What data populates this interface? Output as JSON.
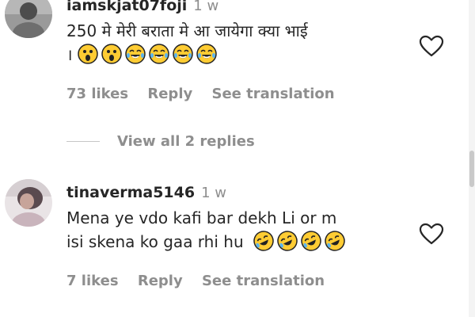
{
  "comments": [
    {
      "username": "iamskjat07foji",
      "time": "1 w",
      "lines": [
        "250 मे मेरी बराता मे आ जायेगा क्या भाई"
      ],
      "line2_prefix": "।",
      "emojis": [
        "astonished-face",
        "astonished-face",
        "joy-face",
        "joy-face",
        "joy-face",
        "joy-face"
      ],
      "likes": "73 likes",
      "reply": "Reply",
      "translate": "See translation"
    },
    {
      "username": "tinaverma5146",
      "time": "1 w",
      "lines": [
        "Mena ye vdo kafi bar dekh Li or m",
        "isi skena ko gaa rhi hu"
      ],
      "emojis": [
        "rofl-face",
        "rofl-face",
        "rofl-face",
        "rofl-face"
      ],
      "likes": "7 likes",
      "reply": "Reply",
      "translate": "See translation"
    }
  ],
  "view_replies": "View all 2 replies",
  "icons": {
    "like": "heart-outline-icon"
  },
  "colors": {
    "text": "#262626",
    "secondary": "#8e8e8e",
    "emoji": "#ffcc33"
  }
}
